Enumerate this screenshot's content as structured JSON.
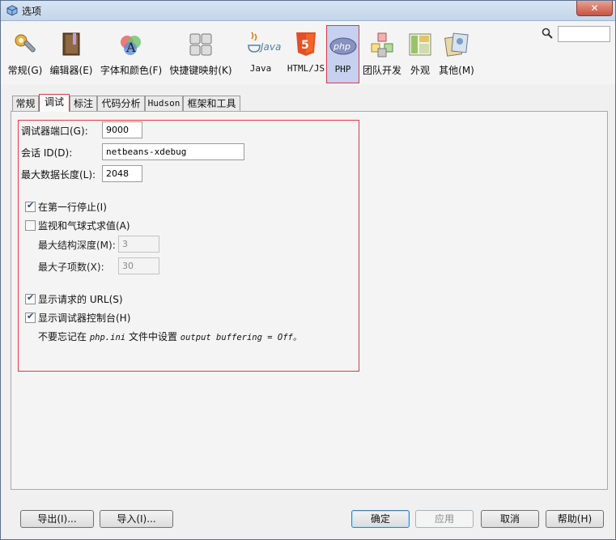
{
  "window": {
    "title": "选项",
    "close_label": "✕"
  },
  "categories": [
    {
      "label": "常规(G)",
      "icon": "general-settings-icon"
    },
    {
      "label": "编辑器(E)",
      "icon": "editor-icon"
    },
    {
      "label": "字体和颜色(F)",
      "icon": "fonts-colors-icon"
    },
    {
      "label": "快捷键映射(K)",
      "icon": "keymap-icon"
    },
    {
      "label": "Java",
      "icon": "java-icon"
    },
    {
      "label": "HTML/JS",
      "icon": "html5-icon"
    },
    {
      "label": "PHP",
      "icon": "php-icon",
      "selected": true
    },
    {
      "label": "团队开发",
      "icon": "team-icon"
    },
    {
      "label": "外观",
      "icon": "appearance-icon"
    },
    {
      "label": "其他(M)",
      "icon": "misc-icon"
    }
  ],
  "search": {
    "value": "",
    "placeholder": ""
  },
  "tabs": [
    {
      "label": "常规"
    },
    {
      "label": "调试",
      "active": true
    },
    {
      "label": "标注"
    },
    {
      "label": "代码分析"
    },
    {
      "label": "Hudson"
    },
    {
      "label": "框架和工具"
    }
  ],
  "debug": {
    "port_label": "调试器端口(G):",
    "port_value": "9000",
    "session_label": "会话 ID(D):",
    "session_value": "netbeans-xdebug",
    "maxlen_label": "最大数据长度(L):",
    "maxlen_value": "2048",
    "stop_first_line": {
      "label": "在第一行停止(I)",
      "checked": true
    },
    "watch_balloon": {
      "label": "监视和气球式求值(A)",
      "checked": false
    },
    "max_depth_label": "最大结构深度(M):",
    "max_depth_value": "3",
    "max_children_label": "最大子项数(X):",
    "max_children_value": "30",
    "show_url": {
      "label": "显示请求的 URL(S)",
      "checked": true
    },
    "show_console": {
      "label": "显示调试器控制台(H)",
      "checked": true
    },
    "hint_prefix": "不要忘记在",
    "hint_file": "php.ini",
    "hint_mid": "文件中设置",
    "hint_setting": "output buffering = Off。"
  },
  "footer": {
    "export_label": "导出(I)...",
    "import_label": "导入(I)...",
    "ok_label": "确定",
    "apply_label": "应用",
    "cancel_label": "取消",
    "help_label": "帮助(H)"
  },
  "colors": {
    "highlight_border": "#e4383e",
    "selected_bg": "#c5d1ee"
  }
}
